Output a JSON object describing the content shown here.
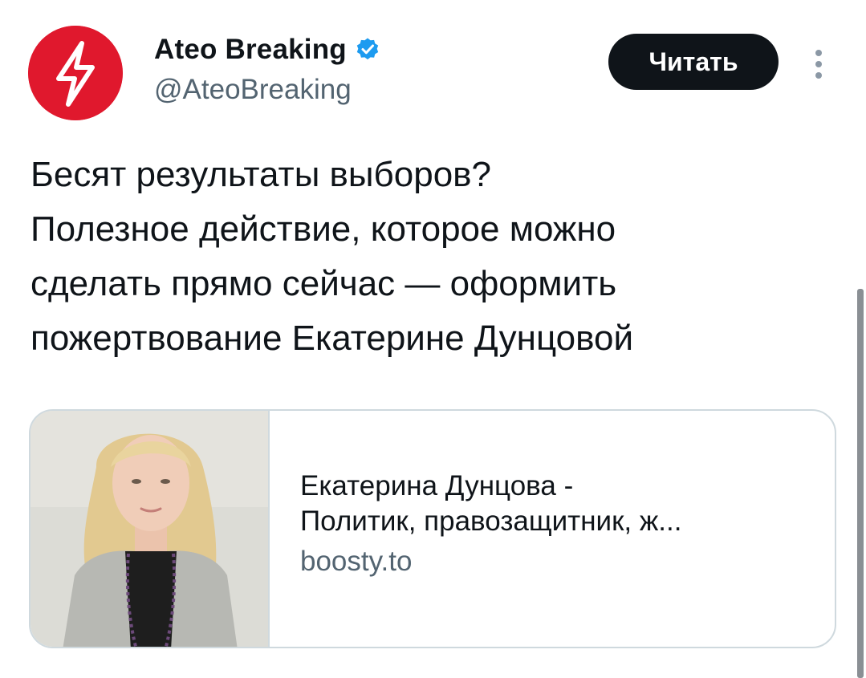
{
  "tweet": {
    "author": {
      "display_name": "Ateo Breaking",
      "handle": "@AteoBreaking",
      "verified": true,
      "avatar_icon": "lightning-bolt-icon",
      "avatar_color": "#e0182d"
    },
    "follow_button_label": "Читать",
    "more_icon": "vertical-ellipsis-icon",
    "text": "Бесят результаты выборов?\nПолезное действие, которое можно\nсделать прямо сейчас — оформить\nпожертвование Екатерине Дунцовой",
    "link_card": {
      "title_line1": "Екатерина Дунцова -",
      "title_line2": "Политик, правозащитник, ж...",
      "domain": "boosty.to"
    }
  },
  "colors": {
    "text_primary": "#0f1419",
    "text_secondary": "#536471",
    "verified_blue": "#1d9bf0",
    "border": "#cfd9de",
    "button_bg": "#0f1419"
  }
}
